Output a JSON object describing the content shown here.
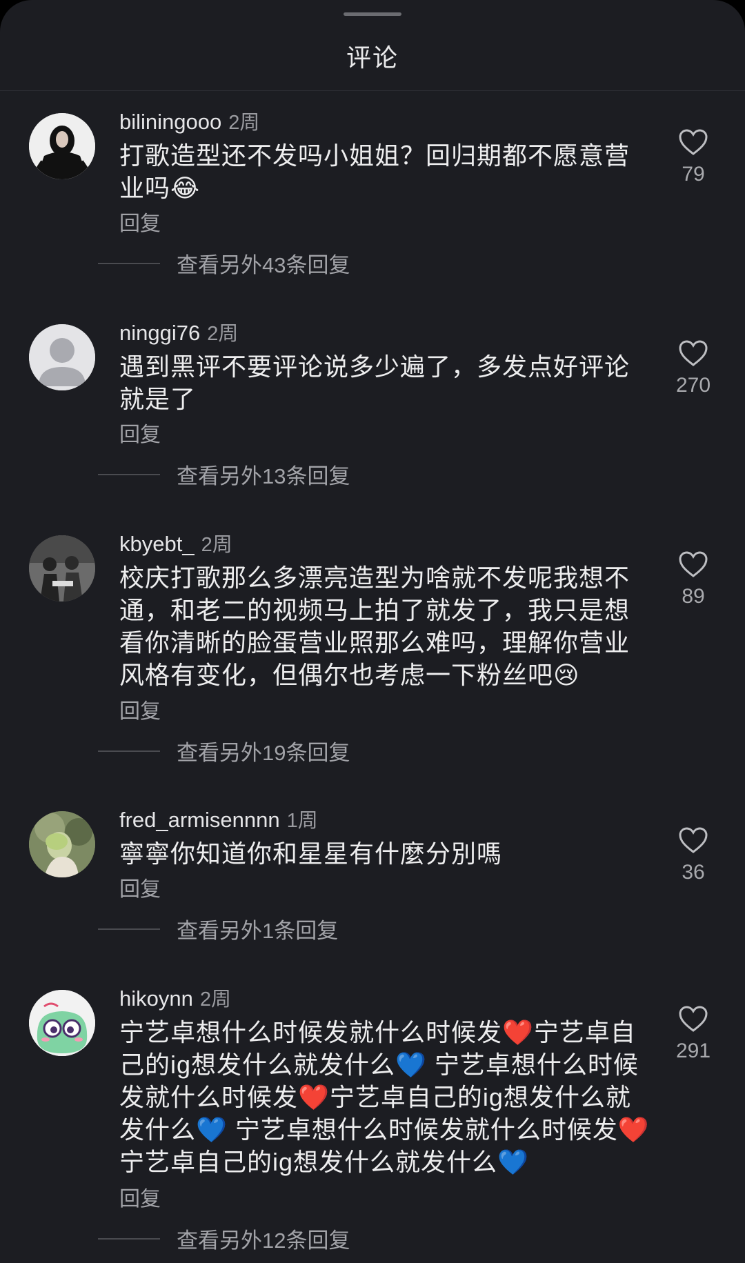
{
  "header": {
    "title": "评论"
  },
  "comments": [
    {
      "username": "biliningooo",
      "time": "2周",
      "text": "打歌造型还不发吗小姐姐？回归期都不愿意营业吗😂",
      "likes": "79",
      "reply_label": "回复",
      "more_replies": "查看另外43条回复"
    },
    {
      "username": "ninggi76",
      "time": "2周",
      "text": "遇到黑评不要评论说多少遍了，多发点好评论就是了",
      "likes": "270",
      "reply_label": "回复",
      "more_replies": "查看另外13条回复"
    },
    {
      "username": "kbyebt_",
      "time": "2周",
      "text": "校庆打歌那么多漂亮造型为啥就不发呢我想不通，和老二的视频马上拍了就发了，我只是想看你清晰的脸蛋营业照那么难吗，理解你营业风格有变化，但偶尔也考虑一下粉丝吧😢",
      "likes": "89",
      "reply_label": "回复",
      "more_replies": "查看另外19条回复"
    },
    {
      "username": "fred_armisennnn",
      "time": "1周",
      "text": "寧寧你知道你和星星有什麼分別嗎",
      "likes": "36",
      "reply_label": "回复",
      "more_replies": "查看另外1条回复"
    },
    {
      "username": "hikoynn",
      "time": "2周",
      "text": "宁艺卓想什么时候发就什么时候发❤️宁艺卓自己的ig想发什么就发什么💙 宁艺卓想什么时候发就什么时候发❤️宁艺卓自己的ig想发什么就发什么💙 宁艺卓想什么时候发就什么时候发❤️宁艺卓自己的ig想发什么就发什么💙",
      "likes": "291",
      "reply_label": "回复",
      "more_replies": "查看另外12条回复"
    }
  ],
  "icons": {
    "like": "heart-outline-icon"
  }
}
